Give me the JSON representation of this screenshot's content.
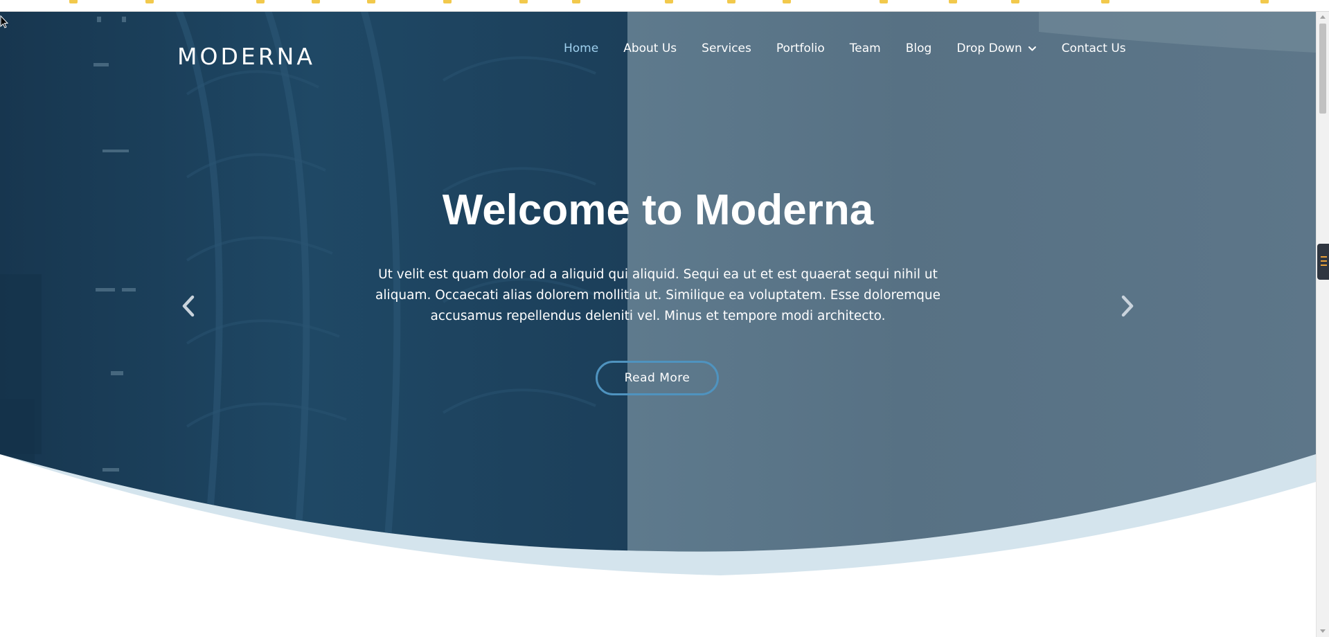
{
  "brand": {
    "logo": "MODERNA"
  },
  "nav": {
    "items": [
      {
        "label": "Home",
        "active": true
      },
      {
        "label": "About Us"
      },
      {
        "label": "Services"
      },
      {
        "label": "Portfolio"
      },
      {
        "label": "Team"
      },
      {
        "label": "Blog"
      },
      {
        "label": "Drop Down",
        "has_dropdown": true
      },
      {
        "label": "Contact Us"
      }
    ]
  },
  "hero": {
    "title": "Welcome to Moderna",
    "text": "Ut velit est quam dolor ad a aliquid qui aliquid. Sequi ea ut et est quaerat sequi nihil ut aliquam. Occaecati alias dolorem mollitia ut. Similique ea voluptatem. Esse doloremque accusamus repellendus deleniti vel. Minus et tempore modi architecto.",
    "button": "Read More"
  },
  "icons": {
    "prev": "chevron-left-icon",
    "next": "chevron-right-icon",
    "dropdown": "chevron-down-icon"
  },
  "colors": {
    "overlay_dark": "#1e3d59",
    "overlay_light": "#5b7587",
    "active_link": "#9fd0ee",
    "button_border": "#4f93bf",
    "wave_light": "#d4e4ed"
  }
}
